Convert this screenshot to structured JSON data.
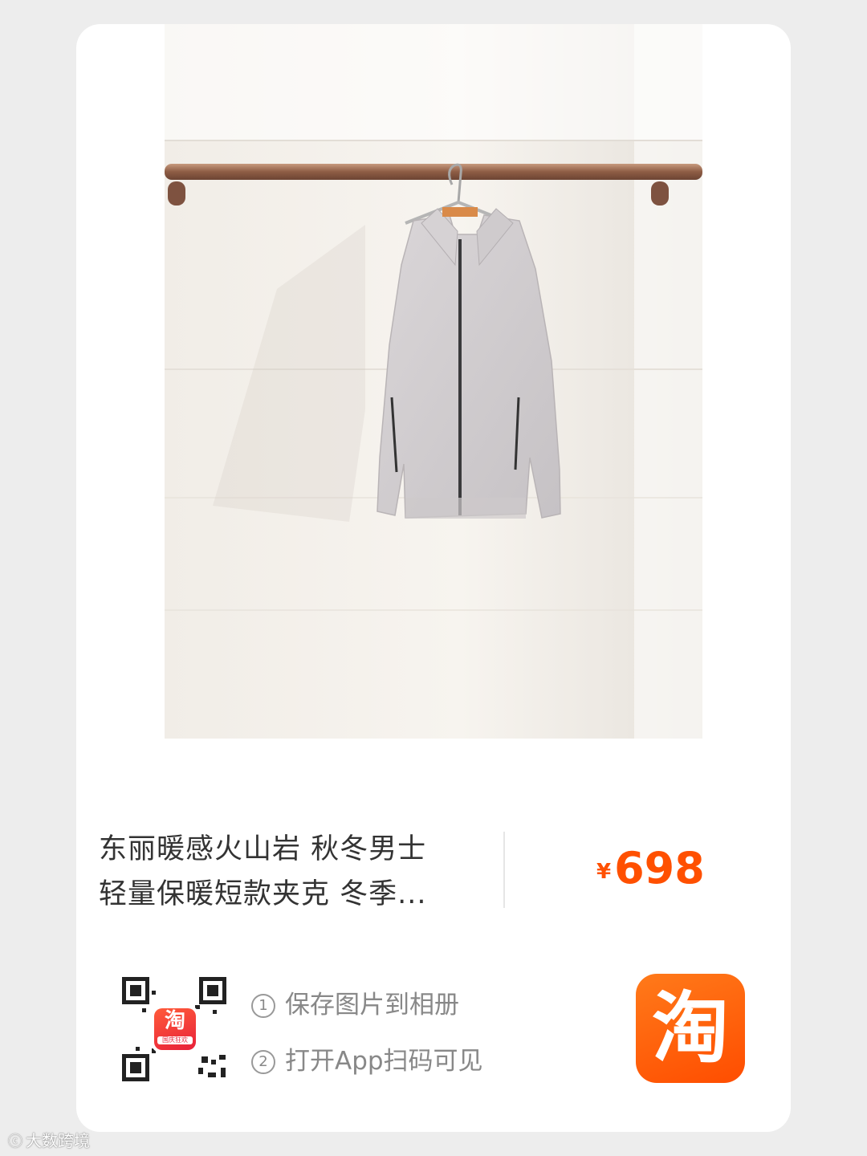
{
  "product": {
    "title_line1": "东丽暖感火山岩 秋冬男士",
    "title_line2": "轻量保暖短款夹克 冬季...",
    "price_symbol": "¥",
    "price_value": "698"
  },
  "qr": {
    "badge_label": "淘",
    "badge_tag": "国庆狂欢"
  },
  "steps": [
    {
      "num": "①",
      "text": "保存图片到相册"
    },
    {
      "num": "②",
      "text": "打开App扫码可见"
    }
  ],
  "app_logo": {
    "label": "淘",
    "icon": "taobao-logo-icon"
  },
  "watermark": {
    "text": "大数跨境",
    "icon": "watermark-logo-icon"
  },
  "colors": {
    "price": "#ff5000",
    "app_orange": "#ff5a00",
    "background": "#ededed"
  }
}
